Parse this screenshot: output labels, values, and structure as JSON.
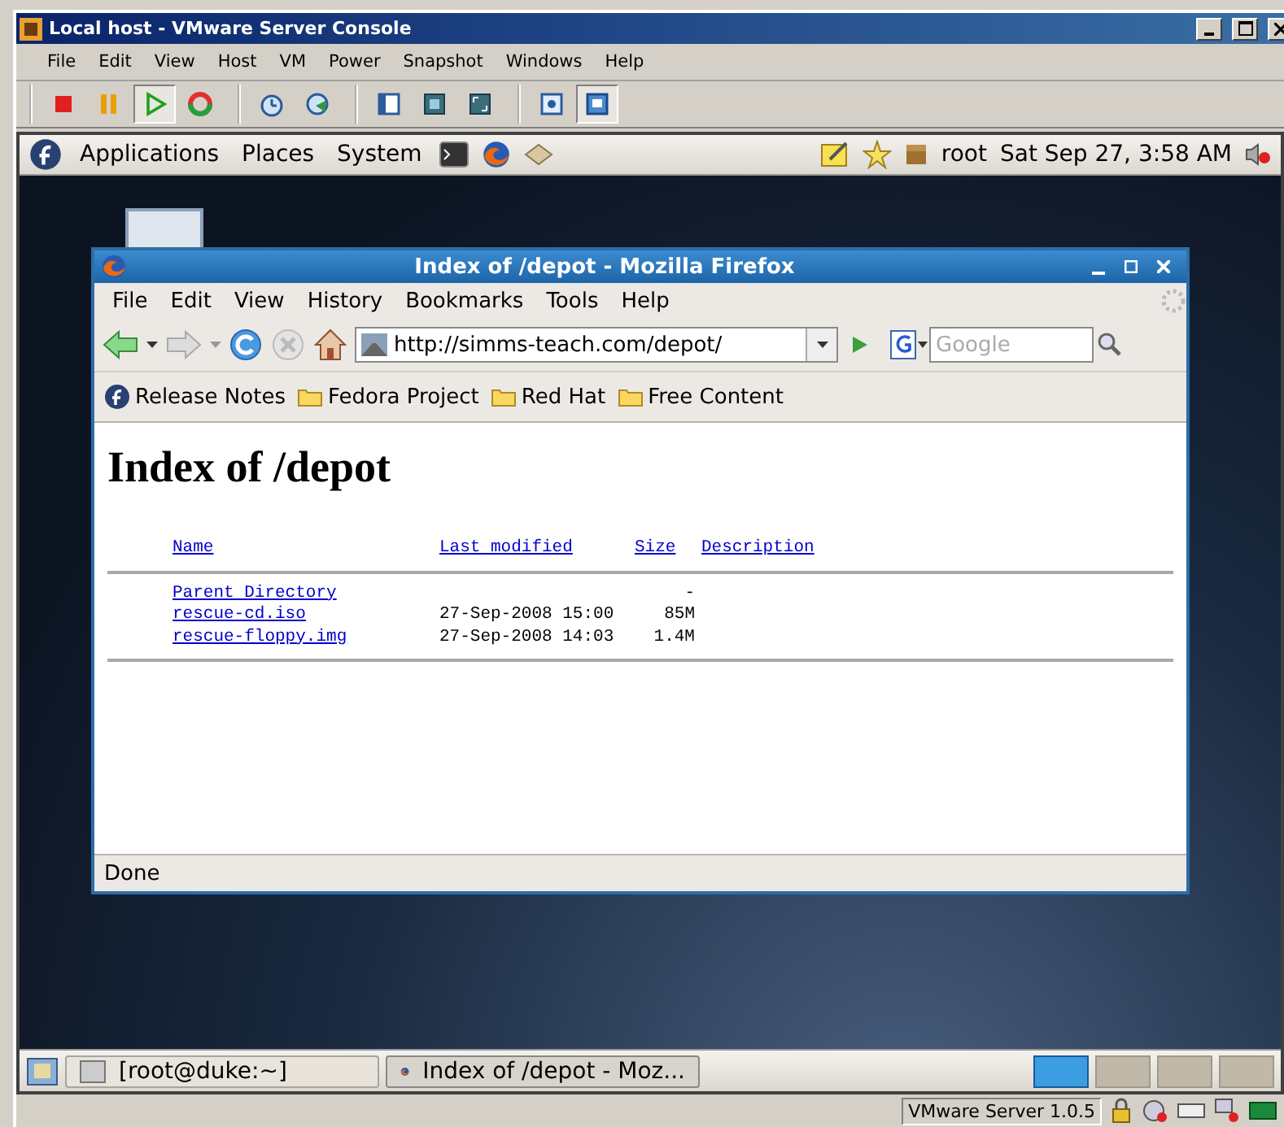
{
  "console": {
    "title": "Local host - VMware Server Console",
    "menu": [
      "File",
      "Edit",
      "View",
      "Host",
      "VM",
      "Power",
      "Snapshot",
      "Windows",
      "Help"
    ],
    "toolbar_groups": [
      {
        "buttons": [
          {
            "kind": "stop",
            "pressed": false
          },
          {
            "kind": "pause",
            "pressed": false
          },
          {
            "kind": "play",
            "pressed": true
          },
          {
            "kind": "reset",
            "pressed": false
          }
        ]
      },
      {
        "buttons": [
          {
            "kind": "snapshot",
            "pressed": false
          },
          {
            "kind": "revert",
            "pressed": false
          }
        ]
      },
      {
        "buttons": [
          {
            "kind": "sidebar",
            "pressed": false
          },
          {
            "kind": "fullscreen",
            "pressed": false
          },
          {
            "kind": "fit",
            "pressed": false
          }
        ]
      },
      {
        "buttons": [
          {
            "kind": "summary",
            "pressed": false
          },
          {
            "kind": "console",
            "pressed": true
          }
        ]
      }
    ]
  },
  "guest_panel": {
    "menus": [
      "Applications",
      "Places",
      "System"
    ],
    "user": "root",
    "clock": "Sat Sep 27, 3:58 AM"
  },
  "firefox": {
    "title": "Index of /depot - Mozilla Firefox",
    "menu": [
      "File",
      "Edit",
      "View",
      "History",
      "Bookmarks",
      "Tools",
      "Help"
    ],
    "address": "http://simms-teach.com/depot/",
    "search": {
      "placeholder": "Google"
    },
    "bookmarks": [
      {
        "label": "Release Notes",
        "kind": "fedora"
      },
      {
        "label": "Fedora Project",
        "kind": "folder"
      },
      {
        "label": "Red Hat",
        "kind": "folder"
      },
      {
        "label": "Free Content",
        "kind": "folder"
      }
    ],
    "page": {
      "heading": "Index of /depot",
      "columns": [
        "Name",
        "Last modified",
        "Size",
        "Description"
      ],
      "rows": [
        {
          "name": "Parent Directory",
          "modified": "",
          "size": "-"
        },
        {
          "name": "rescue-cd.iso",
          "modified": "27-Sep-2008 15:00",
          "size": "85M"
        },
        {
          "name": "rescue-floppy.img",
          "modified": "27-Sep-2008 14:03",
          "size": "1.4M"
        }
      ]
    },
    "status": "Done"
  },
  "taskbar": {
    "tasks": [
      {
        "label": "[root@duke:~]",
        "kind": "terminal",
        "selected": false
      },
      {
        "label": "Index of /depot - Moz...",
        "kind": "firefox",
        "selected": true
      }
    ],
    "workspaces": [
      {
        "selected": true
      },
      {
        "selected": false
      },
      {
        "selected": false
      },
      {
        "selected": false
      }
    ]
  },
  "status_bar": {
    "version": "VMware Server 1.0.5"
  }
}
